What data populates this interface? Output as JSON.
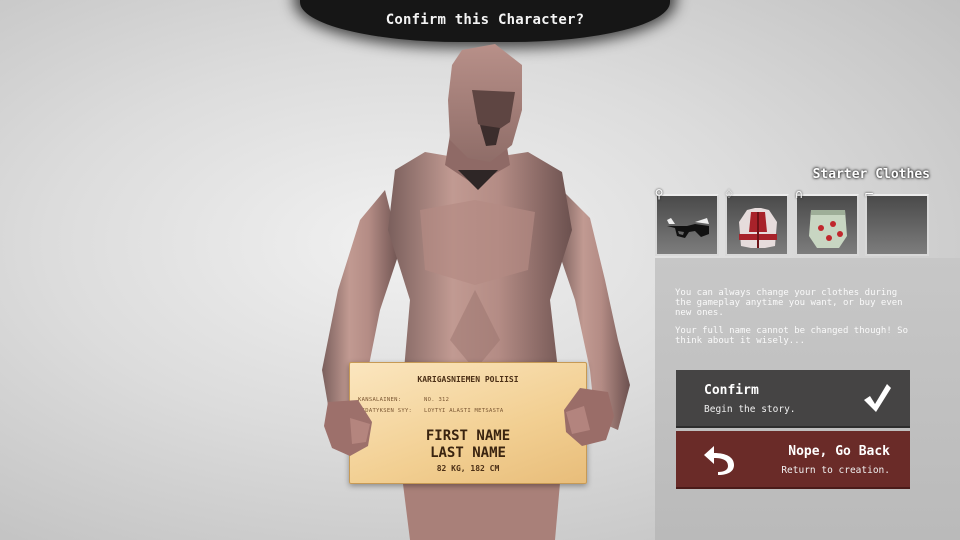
{
  "header": {
    "title": "Confirm this Character?"
  },
  "sign": {
    "header": "KARIGASNIEMEN POLIISI",
    "rows": [
      {
        "label": "KANSALAINEN:",
        "value": "NO. 312"
      },
      {
        "label": "PIDATYKSEN SYY:",
        "value": "LOYTYI ALASTI METSASTA"
      }
    ],
    "first_name": "FIRST NAME",
    "last_name": "LAST NAME",
    "stats": "82 KG, 182 CM"
  },
  "clothes": {
    "title": "Starter Clothes",
    "slots": [
      {
        "slot_icon": "glasses-slot-icon",
        "item": "sunglasses"
      },
      {
        "slot_icon": "shirt-slot-icon",
        "item": "red-white-jacket"
      },
      {
        "slot_icon": "pants-slot-icon",
        "item": "patterned-pants"
      },
      {
        "slot_icon": "shoes-slot-icon",
        "item": ""
      }
    ]
  },
  "info": {
    "text1": "You can always change your clothes during the gameplay anytime you want, or buy even new ones.",
    "text2": "Your full name cannot be changed though! So think about it wisely..."
  },
  "buttons": {
    "confirm": {
      "label": "Confirm",
      "sub": "Begin the story.",
      "icon": "check-icon",
      "color": "#454444"
    },
    "back": {
      "label": "Nope, Go Back",
      "sub": "Return to creation.",
      "icon": "return-arrow-icon",
      "color": "#6a2b28"
    }
  }
}
